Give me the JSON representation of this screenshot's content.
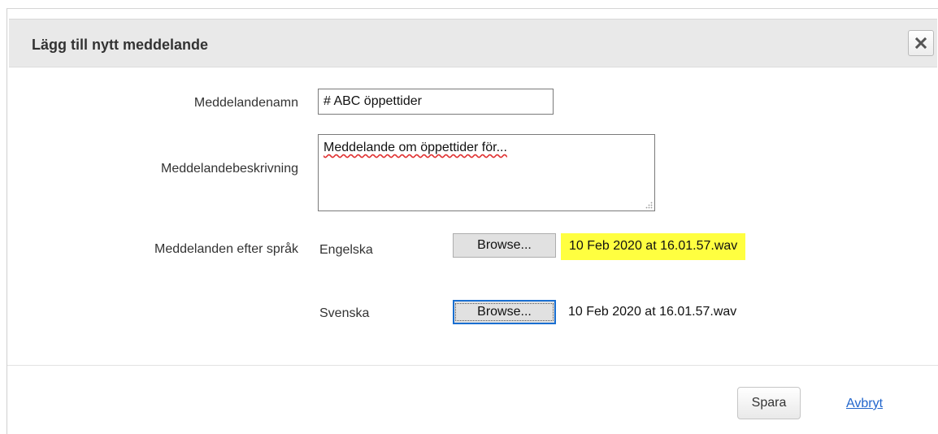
{
  "dialog": {
    "title": "Lägg till nytt meddelande",
    "close_icon": "close-icon"
  },
  "form": {
    "name_label": "Meddelandenamn",
    "name_value": "# ABC öppettider",
    "description_label": "Meddelandebeskrivning",
    "description_value": "Meddelande om öppettider för...",
    "languages_label": "Meddelanden efter språk",
    "languages": [
      {
        "language": "Engelska",
        "browse_label": "Browse...",
        "file": "10 Feb 2020 at 16.01.57.wav",
        "highlighted": true
      },
      {
        "language": "Svenska",
        "browse_label": "Browse...",
        "file": "10 Feb 2020 at 16.01.57.wav",
        "focused": true
      }
    ]
  },
  "footer": {
    "save_label": "Spara",
    "cancel_label": "Avbryt"
  },
  "colors": {
    "highlight": "#ffff40",
    "link": "#2266cc",
    "focus": "#1a6fd1"
  }
}
